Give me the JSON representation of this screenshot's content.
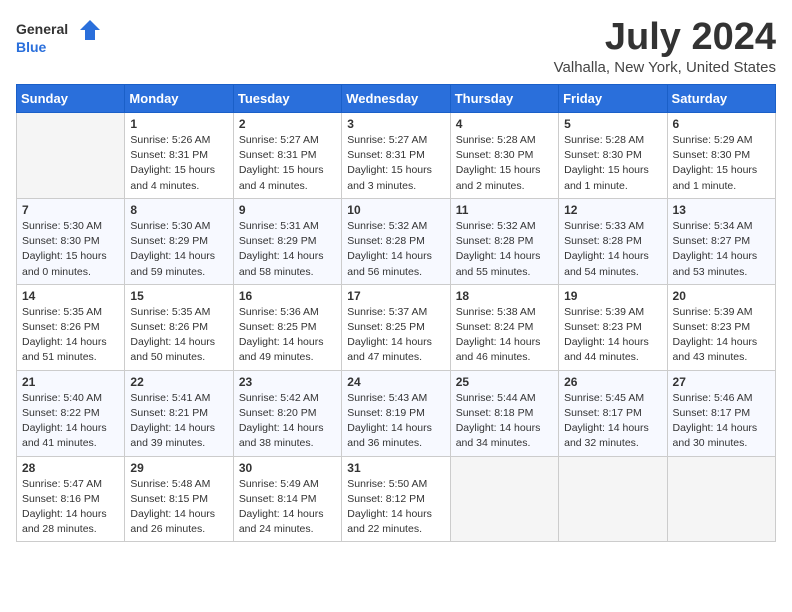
{
  "header": {
    "logo_general": "General",
    "logo_blue": "Blue",
    "title": "July 2024",
    "subtitle": "Valhalla, New York, United States"
  },
  "calendar": {
    "days_of_week": [
      "Sunday",
      "Monday",
      "Tuesday",
      "Wednesday",
      "Thursday",
      "Friday",
      "Saturday"
    ],
    "weeks": [
      [
        {
          "day": "",
          "content": ""
        },
        {
          "day": "1",
          "content": "Sunrise: 5:26 AM\nSunset: 8:31 PM\nDaylight: 15 hours\nand 4 minutes."
        },
        {
          "day": "2",
          "content": "Sunrise: 5:27 AM\nSunset: 8:31 PM\nDaylight: 15 hours\nand 4 minutes."
        },
        {
          "day": "3",
          "content": "Sunrise: 5:27 AM\nSunset: 8:31 PM\nDaylight: 15 hours\nand 3 minutes."
        },
        {
          "day": "4",
          "content": "Sunrise: 5:28 AM\nSunset: 8:30 PM\nDaylight: 15 hours\nand 2 minutes."
        },
        {
          "day": "5",
          "content": "Sunrise: 5:28 AM\nSunset: 8:30 PM\nDaylight: 15 hours\nand 1 minute."
        },
        {
          "day": "6",
          "content": "Sunrise: 5:29 AM\nSunset: 8:30 PM\nDaylight: 15 hours\nand 1 minute."
        }
      ],
      [
        {
          "day": "7",
          "content": "Sunrise: 5:30 AM\nSunset: 8:30 PM\nDaylight: 15 hours\nand 0 minutes."
        },
        {
          "day": "8",
          "content": "Sunrise: 5:30 AM\nSunset: 8:29 PM\nDaylight: 14 hours\nand 59 minutes."
        },
        {
          "day": "9",
          "content": "Sunrise: 5:31 AM\nSunset: 8:29 PM\nDaylight: 14 hours\nand 58 minutes."
        },
        {
          "day": "10",
          "content": "Sunrise: 5:32 AM\nSunset: 8:28 PM\nDaylight: 14 hours\nand 56 minutes."
        },
        {
          "day": "11",
          "content": "Sunrise: 5:32 AM\nSunset: 8:28 PM\nDaylight: 14 hours\nand 55 minutes."
        },
        {
          "day": "12",
          "content": "Sunrise: 5:33 AM\nSunset: 8:28 PM\nDaylight: 14 hours\nand 54 minutes."
        },
        {
          "day": "13",
          "content": "Sunrise: 5:34 AM\nSunset: 8:27 PM\nDaylight: 14 hours\nand 53 minutes."
        }
      ],
      [
        {
          "day": "14",
          "content": "Sunrise: 5:35 AM\nSunset: 8:26 PM\nDaylight: 14 hours\nand 51 minutes."
        },
        {
          "day": "15",
          "content": "Sunrise: 5:35 AM\nSunset: 8:26 PM\nDaylight: 14 hours\nand 50 minutes."
        },
        {
          "day": "16",
          "content": "Sunrise: 5:36 AM\nSunset: 8:25 PM\nDaylight: 14 hours\nand 49 minutes."
        },
        {
          "day": "17",
          "content": "Sunrise: 5:37 AM\nSunset: 8:25 PM\nDaylight: 14 hours\nand 47 minutes."
        },
        {
          "day": "18",
          "content": "Sunrise: 5:38 AM\nSunset: 8:24 PM\nDaylight: 14 hours\nand 46 minutes."
        },
        {
          "day": "19",
          "content": "Sunrise: 5:39 AM\nSunset: 8:23 PM\nDaylight: 14 hours\nand 44 minutes."
        },
        {
          "day": "20",
          "content": "Sunrise: 5:39 AM\nSunset: 8:23 PM\nDaylight: 14 hours\nand 43 minutes."
        }
      ],
      [
        {
          "day": "21",
          "content": "Sunrise: 5:40 AM\nSunset: 8:22 PM\nDaylight: 14 hours\nand 41 minutes."
        },
        {
          "day": "22",
          "content": "Sunrise: 5:41 AM\nSunset: 8:21 PM\nDaylight: 14 hours\nand 39 minutes."
        },
        {
          "day": "23",
          "content": "Sunrise: 5:42 AM\nSunset: 8:20 PM\nDaylight: 14 hours\nand 38 minutes."
        },
        {
          "day": "24",
          "content": "Sunrise: 5:43 AM\nSunset: 8:19 PM\nDaylight: 14 hours\nand 36 minutes."
        },
        {
          "day": "25",
          "content": "Sunrise: 5:44 AM\nSunset: 8:18 PM\nDaylight: 14 hours\nand 34 minutes."
        },
        {
          "day": "26",
          "content": "Sunrise: 5:45 AM\nSunset: 8:17 PM\nDaylight: 14 hours\nand 32 minutes."
        },
        {
          "day": "27",
          "content": "Sunrise: 5:46 AM\nSunset: 8:17 PM\nDaylight: 14 hours\nand 30 minutes."
        }
      ],
      [
        {
          "day": "28",
          "content": "Sunrise: 5:47 AM\nSunset: 8:16 PM\nDaylight: 14 hours\nand 28 minutes."
        },
        {
          "day": "29",
          "content": "Sunrise: 5:48 AM\nSunset: 8:15 PM\nDaylight: 14 hours\nand 26 minutes."
        },
        {
          "day": "30",
          "content": "Sunrise: 5:49 AM\nSunset: 8:14 PM\nDaylight: 14 hours\nand 24 minutes."
        },
        {
          "day": "31",
          "content": "Sunrise: 5:50 AM\nSunset: 8:12 PM\nDaylight: 14 hours\nand 22 minutes."
        },
        {
          "day": "",
          "content": ""
        },
        {
          "day": "",
          "content": ""
        },
        {
          "day": "",
          "content": ""
        }
      ]
    ]
  }
}
